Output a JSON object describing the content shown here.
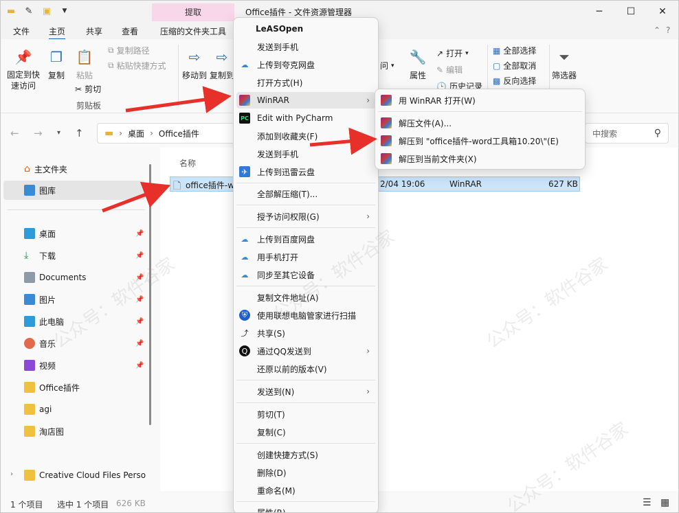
{
  "window": {
    "title": "Office插件 - 文件资源管理器",
    "contextual_tab": "提取",
    "minimize": "─",
    "maximize": "☐",
    "close": "✕"
  },
  "ribbon_tabs": [
    "文件",
    "主页",
    "共享",
    "查看",
    "压缩的文件夹工具"
  ],
  "ribbon": {
    "pin_quick_access": "固定到快速访问",
    "copy": "复制",
    "paste": "粘贴",
    "copy_path": "复制路径",
    "paste_shortcut": "粘贴快捷方式",
    "cut": "剪切",
    "clipboard_group": "剪贴板",
    "move_to": "移动到",
    "copy_to": "复制到",
    "open": "打开",
    "edit": "编辑",
    "history": "历史记录",
    "properties": "属性",
    "select_all": "全部选择",
    "select_none": "全部取消",
    "invert_selection": "反向选择",
    "filter": "筛选器",
    "access_partial": "问"
  },
  "address": {
    "crumbs": [
      "桌面",
      "Office插件"
    ],
    "search_placeholder": "中搜索"
  },
  "nav": {
    "home": "主文件夹",
    "gallery": "图库",
    "items": [
      "桌面",
      "下载",
      "Documents",
      "图片",
      "此电脑",
      "音乐",
      "视频",
      "Office插件",
      "agi",
      "淘店图"
    ],
    "creative_cloud": "Creative Cloud Files Person",
    "this_pc_cut": "此电脑"
  },
  "content": {
    "col_name": "名称",
    "file_name": "office插件-w",
    "file_date": "2/04 19:06",
    "file_type": "WinRAR",
    "file_size": "627 KB"
  },
  "status": {
    "count": "1 个项目",
    "selected": "选中 1 个项目",
    "size": "626 KB"
  },
  "context_menu": {
    "header": "LeASOpen",
    "items": [
      "发送到手机",
      "上传到夸克网盘",
      "打开方式(H)",
      "WinRAR",
      "Edit with PyCharm",
      "添加到收藏夹(F)",
      "发送到手机",
      "上传到迅雷云盘",
      "全部解压缩(T)...",
      "授予访问权限(G)",
      "上传到百度网盘",
      "用手机打开",
      "同步至其它设备",
      "复制文件地址(A)",
      "使用联想电脑管家进行扫描",
      "共享(S)",
      "通过QQ发送到",
      "还原以前的版本(V)",
      "发送到(N)",
      "剪切(T)",
      "复制(C)",
      "创建快捷方式(S)",
      "删除(D)",
      "重命名(M)",
      "属性(R)"
    ]
  },
  "submenu": {
    "items": [
      "用 WinRAR 打开(W)",
      "解压文件(A)...",
      "解压到 \"office插件-word工具箱10.20\\\"(E)",
      "解压到当前文件夹(X)"
    ]
  },
  "watermark": "公众号：软件谷家",
  "colors": {
    "accent": "#0f62b8",
    "selection": "#cce4f7",
    "arrow": "#e8302a"
  }
}
